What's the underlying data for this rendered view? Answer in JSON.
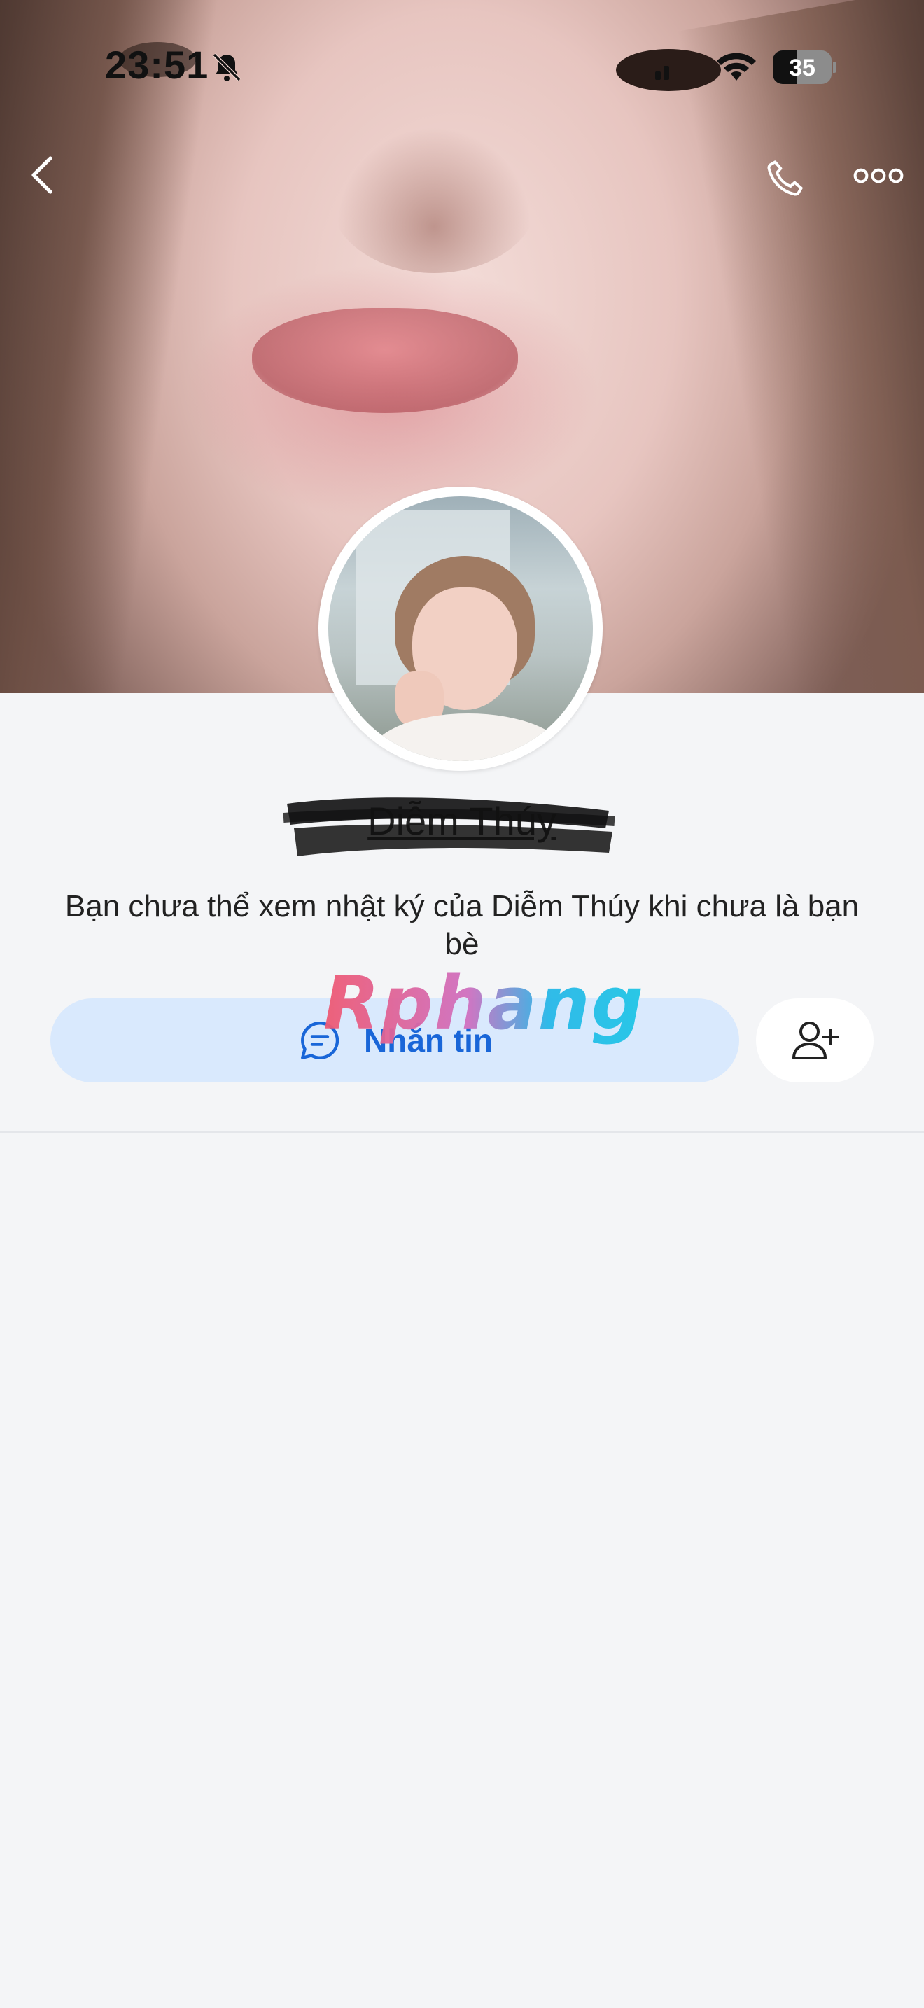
{
  "status_bar": {
    "time": "23:51",
    "battery": "35",
    "icons": [
      "bell-slash-icon",
      "signal-icon",
      "wifi-icon",
      "battery-icon"
    ]
  },
  "nav": {
    "back_icon": "chevron-left-icon",
    "call_icon": "phone-icon",
    "more_icon": "more-dots-icon"
  },
  "profile": {
    "name": "Diễm Thúy",
    "notice": "Bạn chưa thể xem nhật ký của Diễm Thúy khi chưa là bạn bè"
  },
  "actions": {
    "message_label": "Nhắn tin",
    "message_icon": "chat-bubble-icon",
    "add_friend_icon": "add-friend-icon",
    "accent": "#1966d8",
    "message_bg": "#d9e9fd"
  },
  "watermark": "Rphang"
}
